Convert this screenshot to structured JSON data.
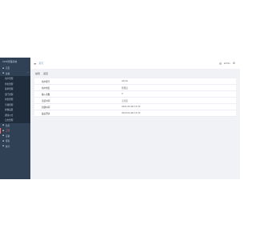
{
  "app": {
    "title": "CDS管理系统"
  },
  "sidebar": {
    "items": [
      {
        "label": "首页",
        "icon": "home-icon"
      },
      {
        "label": "系统",
        "icon": "gear-icon",
        "expanded": true
      },
      {
        "label": "用户管理",
        "sub": true
      },
      {
        "label": "角色管理",
        "sub": true
      },
      {
        "label": "菜单管理",
        "sub": true
      },
      {
        "label": "部门管理",
        "sub": true
      },
      {
        "label": "岗位管理",
        "sub": true
      },
      {
        "label": "字典管理",
        "sub": true
      },
      {
        "label": "参数设置",
        "sub": true
      },
      {
        "label": "通知公告",
        "sub": true
      },
      {
        "label": "日志管理",
        "sub": true
      },
      {
        "label": "监控",
        "icon": "monitor-icon"
      },
      {
        "label": "工具",
        "icon": "tool-icon",
        "active": true
      },
      {
        "label": "设备",
        "icon": "device-icon"
      },
      {
        "label": "报表",
        "icon": "chart-icon"
      },
      {
        "label": "统计",
        "icon": "stats-icon"
      }
    ]
  },
  "header": {
    "breadcrumb": "首页",
    "user": "admin"
  },
  "toolbar": {
    "edit": "编辑",
    "back": "返回"
  },
  "details": [
    {
      "label": "用户账号",
      "value": "admin"
    },
    {
      "label": "用户姓名",
      "value": "管理员"
    },
    {
      "label": "输入次数",
      "value": "0"
    },
    {
      "label": "冻结时间",
      "value": "无冻结"
    },
    {
      "label": "创建时间",
      "value": "2021-05-06 13:23"
    },
    {
      "label": "最后登录",
      "value": "2023-04-06 13:23"
    }
  ],
  "colors": {
    "sidebar": "#304156",
    "accent": "#f56c6c",
    "content_bg": "#f0f2f5"
  }
}
